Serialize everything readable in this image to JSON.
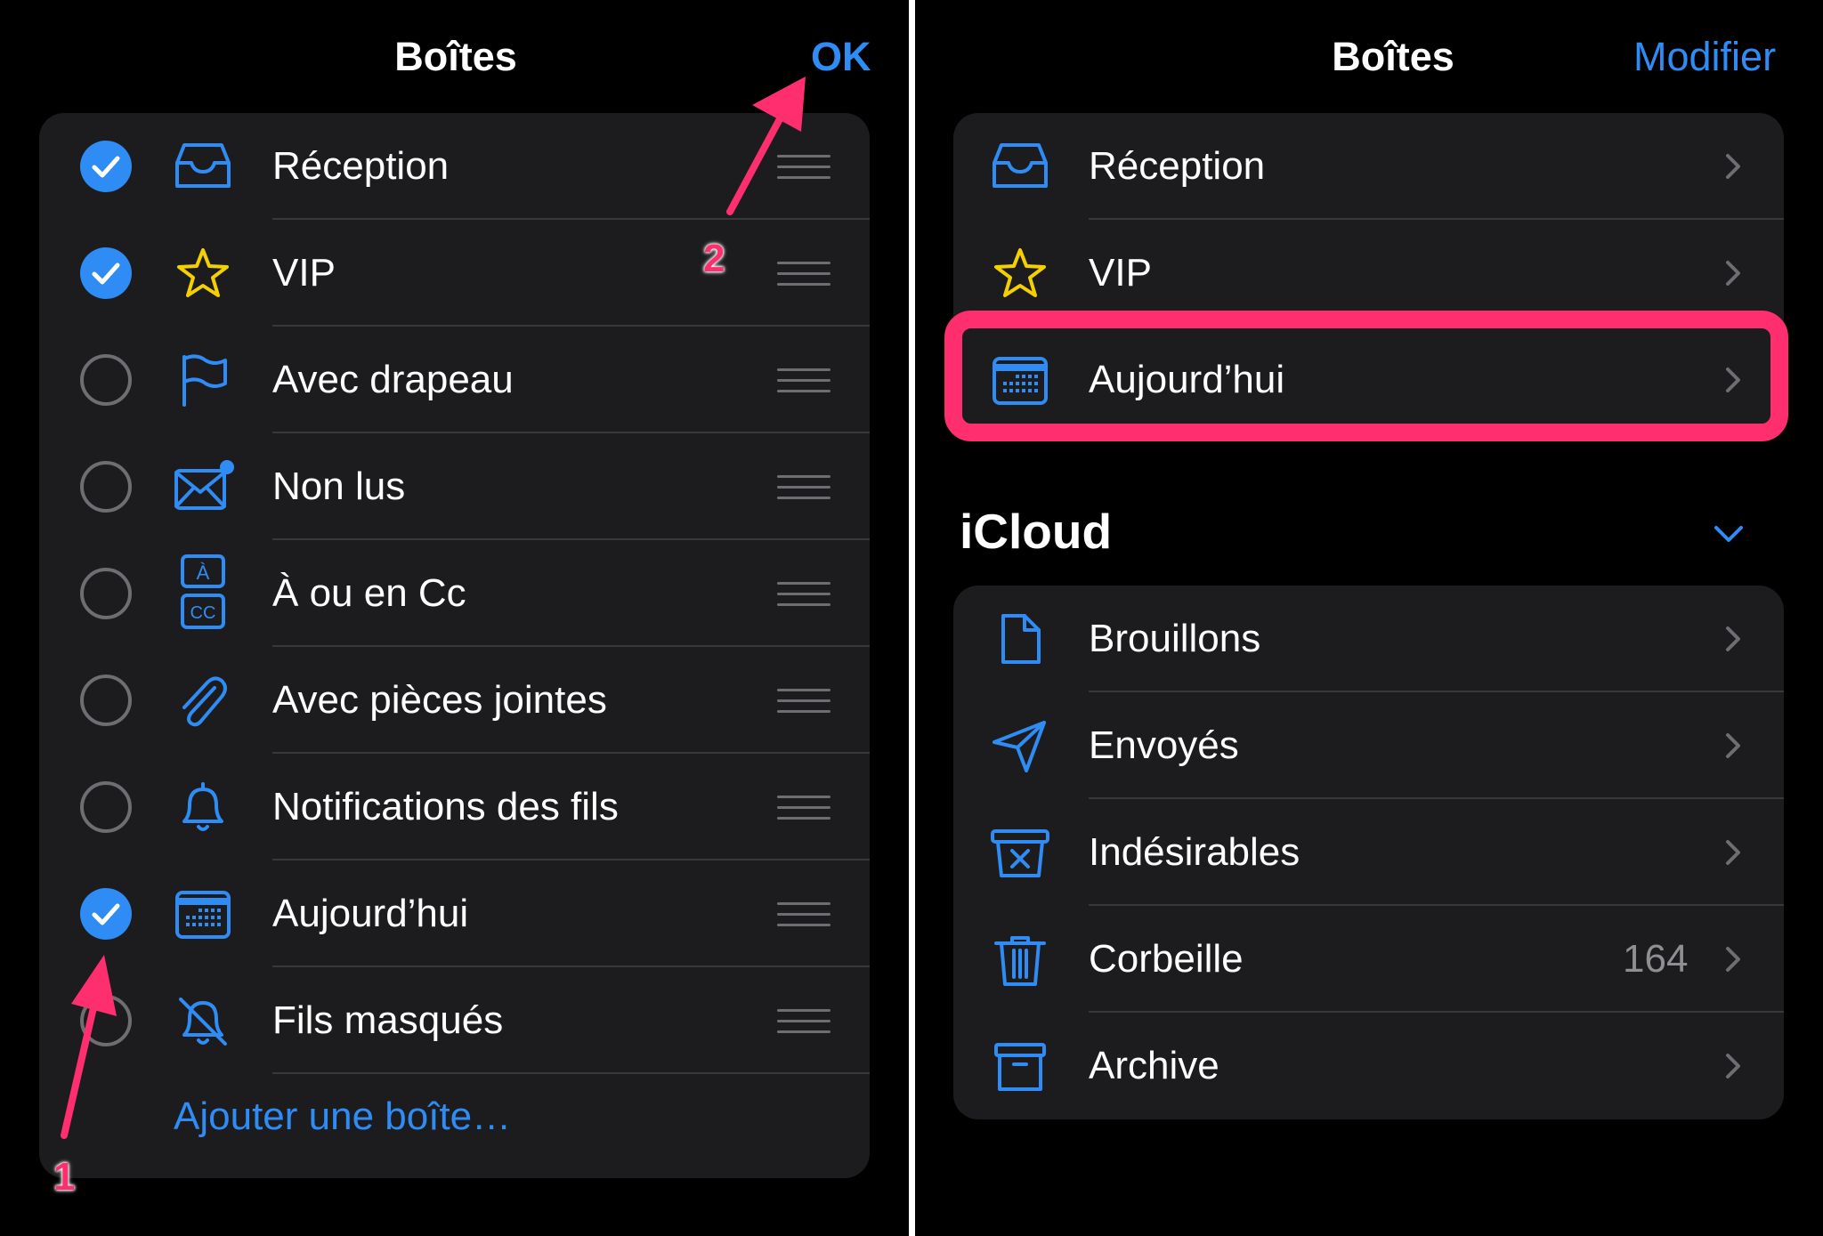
{
  "colors": {
    "accent": "#2f8cf5",
    "highlight": "#ff2e6f",
    "card": "#1c1c1e",
    "star": "#f5d000"
  },
  "left": {
    "title": "Boîtes",
    "done_label": "OK",
    "rows": [
      {
        "label": "Réception",
        "checked": true,
        "icon": "inbox-icon"
      },
      {
        "label": "VIP",
        "checked": true,
        "icon": "star-icon"
      },
      {
        "label": "Avec drapeau",
        "checked": false,
        "icon": "flag-icon"
      },
      {
        "label": "Non lus",
        "checked": false,
        "icon": "unread-envelope-icon"
      },
      {
        "label": "À ou en Cc",
        "checked": false,
        "icon": "to-cc-icon"
      },
      {
        "label": "Avec pièces jointes",
        "checked": false,
        "icon": "paperclip-icon"
      },
      {
        "label": "Notifications des fils",
        "checked": false,
        "icon": "bell-icon"
      },
      {
        "label": "Aujourd’hui",
        "checked": true,
        "icon": "calendar-icon"
      },
      {
        "label": "Fils masqués",
        "checked": false,
        "icon": "bell-slash-icon"
      }
    ],
    "add_label": "Ajouter une boîte…",
    "to_label": "À",
    "cc_label": "CC"
  },
  "right": {
    "title": "Boîtes",
    "edit_label": "Modifier",
    "smart_rows": [
      {
        "label": "Réception",
        "icon": "inbox-icon"
      },
      {
        "label": "VIP",
        "icon": "star-icon"
      },
      {
        "label": "Aujourd’hui",
        "icon": "calendar-icon"
      }
    ],
    "account_title": "iCloud",
    "account_rows": [
      {
        "label": "Brouillons",
        "icon": "document-icon"
      },
      {
        "label": "Envoyés",
        "icon": "paperplane-icon"
      },
      {
        "label": "Indésirables",
        "icon": "junk-icon"
      },
      {
        "label": "Corbeille",
        "icon": "trash-icon",
        "count": "164"
      },
      {
        "label": "Archive",
        "icon": "archive-icon"
      }
    ]
  },
  "annotations": {
    "step1": "1",
    "step2": "2"
  }
}
